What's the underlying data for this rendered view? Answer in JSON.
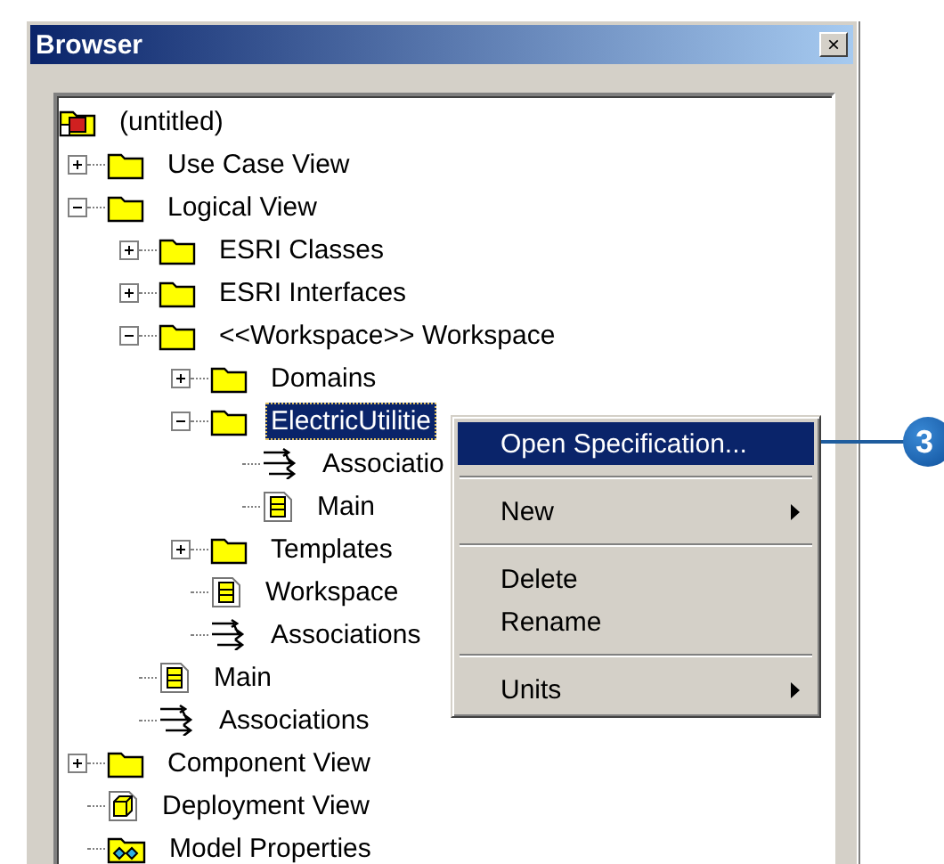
{
  "window": {
    "title": "Browser",
    "close": "×"
  },
  "tree": [
    {
      "label": "(untitled)",
      "kind": "model",
      "selected": false,
      "children": [
        {
          "label": "Use Case View",
          "kind": "folder",
          "expanded": false,
          "selected": false
        },
        {
          "label": "Logical View",
          "kind": "folder",
          "expanded": true,
          "selected": false,
          "children": [
            {
              "label": "ESRI Classes",
              "kind": "folder",
              "expanded": false,
              "selected": false
            },
            {
              "label": "ESRI Interfaces",
              "kind": "folder",
              "expanded": false,
              "selected": false
            },
            {
              "label": "<<Workspace>> Workspace",
              "kind": "folder",
              "expanded": true,
              "selected": false,
              "children": [
                {
                  "label": "Domains",
                  "kind": "folder",
                  "expanded": false,
                  "selected": false
                },
                {
                  "label": "ElectricUtilitie",
                  "kind": "folder",
                  "expanded": true,
                  "selected": true,
                  "children": [
                    {
                      "label": "Associatio",
                      "kind": "associations",
                      "selected": false
                    },
                    {
                      "label": "Main",
                      "kind": "diagram",
                      "selected": false
                    }
                  ]
                },
                {
                  "label": "Templates",
                  "kind": "folder",
                  "expanded": false,
                  "selected": false
                },
                {
                  "label": "Workspace",
                  "kind": "diagram",
                  "selected": false
                },
                {
                  "label": "Associations",
                  "kind": "associations",
                  "selected": false
                }
              ]
            },
            {
              "label": "Main",
              "kind": "diagram",
              "selected": false
            },
            {
              "label": "Associations",
              "kind": "associations",
              "selected": false
            }
          ]
        },
        {
          "label": "Component View",
          "kind": "folder",
          "expanded": false,
          "selected": false
        },
        {
          "label": "Deployment View",
          "kind": "component",
          "selected": false
        },
        {
          "label": "Model Properties",
          "kind": "properties",
          "selected": false
        }
      ]
    }
  ],
  "context_menu": [
    {
      "kind": "item",
      "label": "Open Specification...",
      "selected": true,
      "submenu": false
    },
    {
      "kind": "separator"
    },
    {
      "kind": "item",
      "label": "New",
      "selected": false,
      "submenu": true
    },
    {
      "kind": "separator"
    },
    {
      "kind": "item",
      "label": "Delete",
      "selected": false,
      "submenu": false
    },
    {
      "kind": "item",
      "label": "Rename",
      "selected": false,
      "submenu": false
    },
    {
      "kind": "separator"
    },
    {
      "kind": "item",
      "label": "Units",
      "selected": false,
      "submenu": true
    }
  ],
  "callout": "3"
}
